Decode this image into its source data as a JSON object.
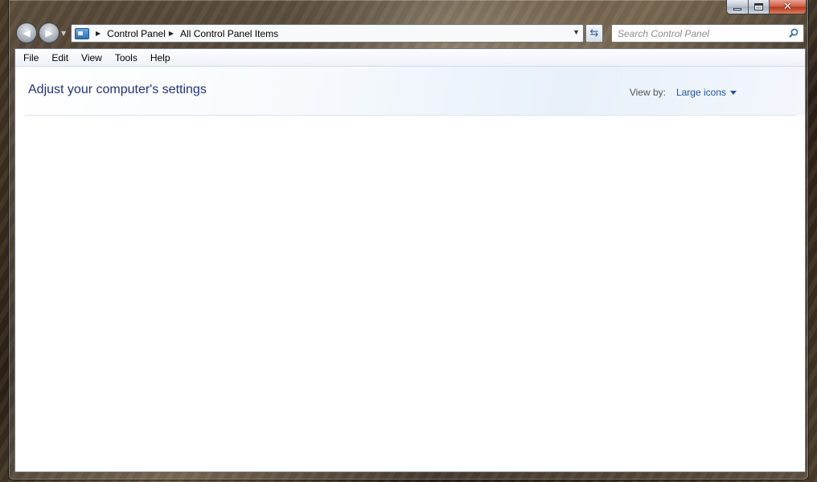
{
  "window": {
    "caption": {
      "minimize": "minimize",
      "maximize": "maximize",
      "close": "close"
    }
  },
  "navigation": {
    "breadcrumbs": [
      "Control Panel",
      "All Control Panel Items"
    ],
    "search": {
      "placeholder": "Search Control Panel",
      "value": ""
    }
  },
  "menu": {
    "items": [
      "File",
      "Edit",
      "View",
      "Tools",
      "Help"
    ]
  },
  "header": {
    "title": "Adjust your computer's settings",
    "view_by_label": "View by:",
    "view_by_value": "Large icons"
  },
  "colors": {
    "title": "#1e3287",
    "link": "#1b55a5"
  },
  "icons": {
    "back": "back-arrow-icon",
    "forward": "forward-arrow-icon",
    "address": "control-panel-icon",
    "refresh": "refresh-icon",
    "search": "search-icon"
  }
}
